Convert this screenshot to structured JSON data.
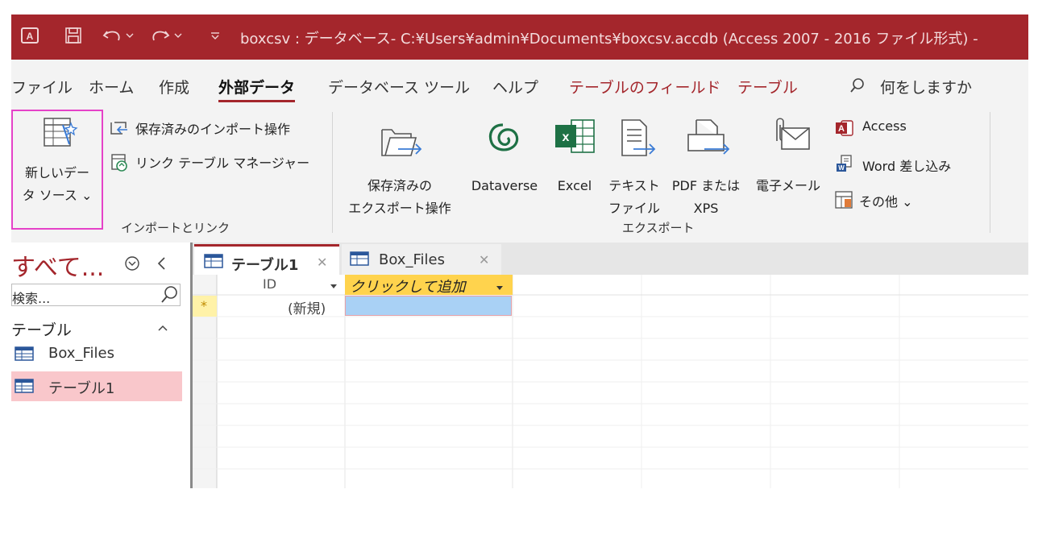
{
  "title_bar": {
    "title": "boxcsv : データベース- C:¥Users¥admin¥Documents¥boxcsv.accdb (Access 2007 - 2016 ファイル形式) -"
  },
  "ribbon_tabs": [
    "ファイル",
    "ホーム",
    "作成",
    "外部データ",
    "データベース ツール",
    "ヘルプ",
    "テーブルのフィールド",
    "テーブル"
  ],
  "active_tab": "外部データ",
  "tell_me": "何をしますか",
  "import_group": {
    "new_source_line1": "新しいデー",
    "new_source_line2": "タ ソース ⌄",
    "saved_imports": "保存済みのインポート操作",
    "linked_table_manager": "リンク テーブル マネージャー",
    "label": "インポートとリンク"
  },
  "export_group": {
    "saved_exports_line1": "保存済みの",
    "saved_exports_line2": "エクスポート操作",
    "dataverse": "Dataverse",
    "excel": "Excel",
    "text_file_line1": "テキスト",
    "text_file_line2": "ファイル",
    "pdf_line1": "PDF または",
    "pdf_line2": "XPS",
    "email": "電子メール",
    "access": "Access",
    "word_merge": "Word 差し込み",
    "more": "その他 ⌄",
    "label": "エクスポート"
  },
  "nav_pane": {
    "title": "すべて...",
    "search_placeholder": "検索...",
    "group": "テーブル",
    "items": [
      "Box_Files",
      "テーブル1"
    ],
    "selected": "テーブル1"
  },
  "doc_tabs": [
    "テーブル1",
    "Box_Files"
  ],
  "active_doc_tab": "テーブル1",
  "datasheet": {
    "columns": [
      "ID",
      "クリックして追加"
    ],
    "new_row_marker": "*",
    "new_row_value": "(新規)"
  },
  "colors": {
    "title_bar": "#a4262c",
    "accent": "#a4262c",
    "highlight_box": "#e542c8",
    "selected_nav_item": "#f9c7cb",
    "add_column_header": "#ffd34d",
    "selected_cell": "#a9d1f5",
    "excel_green": "#1e7145"
  },
  "icons": [
    "access-logo-icon",
    "save-icon",
    "undo-icon",
    "redo-icon",
    "customize-qat-icon",
    "search-icon",
    "new-data-source-icon",
    "saved-imports-icon",
    "linked-table-manager-icon",
    "saved-exports-icon",
    "dataverse-icon",
    "excel-icon",
    "text-file-icon",
    "pdf-xps-icon",
    "email-icon",
    "access-icon",
    "word-merge-icon",
    "more-icon",
    "nav-menu-icon",
    "collapse-pane-icon",
    "table-icon",
    "close-icon"
  ]
}
